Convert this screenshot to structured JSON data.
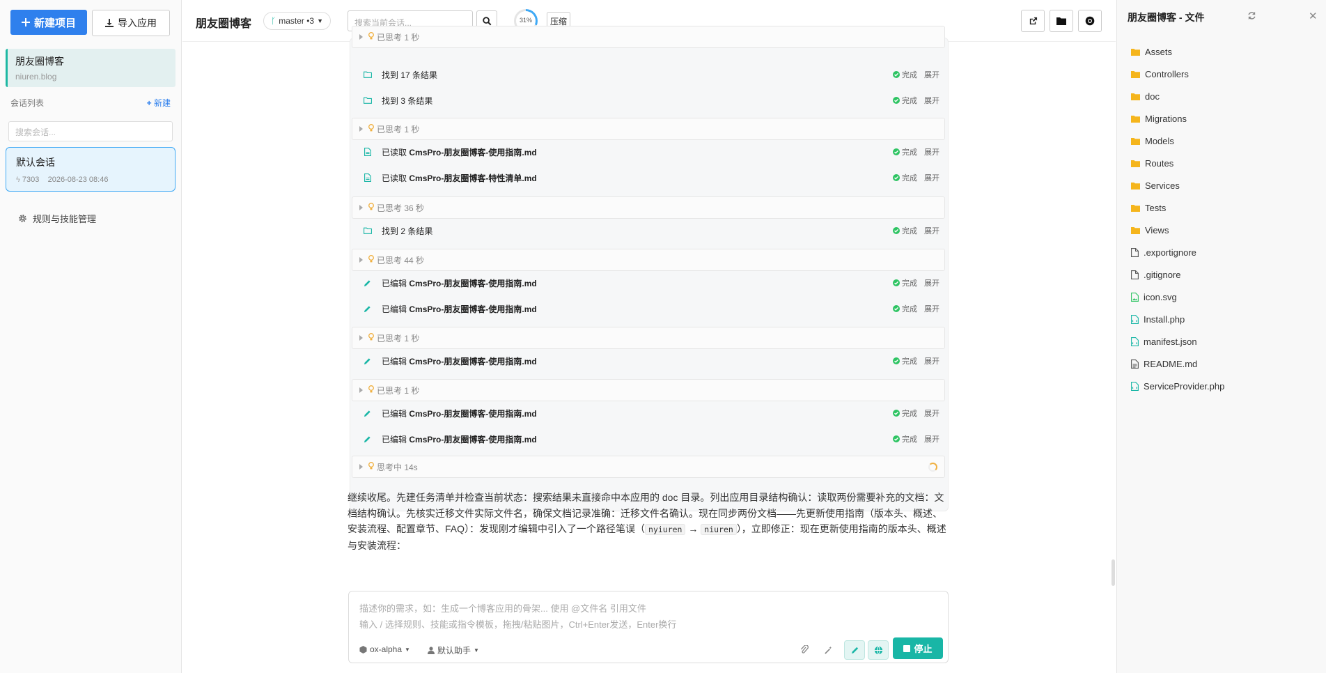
{
  "sidebar": {
    "new_project": "新建项目",
    "import_app": "导入应用",
    "project": {
      "name": "朋友圈博客",
      "domain": "niuren.blog"
    },
    "sessions_label": "会话列表",
    "new_session": "新建",
    "search_placeholder": "搜索会话...",
    "session": {
      "title": "默认会话",
      "count": "7303",
      "time": "2026-08-23 08:46"
    },
    "rules": "规则与技能管理"
  },
  "header": {
    "title": "朋友圈博客",
    "branch": "master •3",
    "search_placeholder": "搜索当前会话...",
    "context_percent": "31%",
    "context_fraction": 0.31,
    "compress": "压缩"
  },
  "steps": [
    {
      "kind": "think",
      "text": "已思考 1 秒"
    },
    {
      "kind": "folder",
      "text": "找到 17 条结果",
      "status": "完成",
      "expand": "展开"
    },
    {
      "kind": "folder",
      "text": "找到 3 条结果",
      "status": "完成",
      "expand": "展开"
    },
    {
      "kind": "think",
      "text": "已思考 1 秒"
    },
    {
      "kind": "read",
      "prefix": "已读取",
      "file": "CmsPro-朋友圈博客-使用指南.md",
      "status": "完成",
      "expand": "展开"
    },
    {
      "kind": "read",
      "prefix": "已读取",
      "file": "CmsPro-朋友圈博客-特性清单.md",
      "status": "完成",
      "expand": "展开"
    },
    {
      "kind": "think",
      "text": "已思考 36 秒"
    },
    {
      "kind": "folder",
      "text": "找到 2 条结果",
      "status": "完成",
      "expand": "展开"
    },
    {
      "kind": "think",
      "text": "已思考 44 秒"
    },
    {
      "kind": "edit",
      "prefix": "已编辑",
      "file": "CmsPro-朋友圈博客-使用指南.md",
      "status": "完成",
      "expand": "展开"
    },
    {
      "kind": "edit",
      "prefix": "已编辑",
      "file": "CmsPro-朋友圈博客-使用指南.md",
      "status": "完成",
      "expand": "展开"
    },
    {
      "kind": "think",
      "text": "已思考 1 秒"
    },
    {
      "kind": "edit",
      "prefix": "已编辑",
      "file": "CmsPro-朋友圈博客-使用指南.md",
      "status": "完成",
      "expand": "展开"
    },
    {
      "kind": "think",
      "text": "已思考 1 秒"
    },
    {
      "kind": "edit",
      "prefix": "已编辑",
      "file": "CmsPro-朋友圈博客-使用指南.md",
      "status": "完成",
      "expand": "展开"
    },
    {
      "kind": "edit",
      "prefix": "已编辑",
      "file": "CmsPro-朋友圈博客-使用指南.md",
      "status": "完成",
      "expand": "展开"
    },
    {
      "kind": "thinking",
      "text": "思考中 14s"
    }
  ],
  "message": {
    "text_1": "继续收尾。先建任务清单并检查当前状态：搜索结果未直接命中本应用的 doc 目录。列出应用目录结构确认：读取两份需要补充的文档：文档结构确认。先核实迁移文件实际文件名，确保文档记录准确：迁移文件名确认。现在同步两份文档——先更新使用指南（版本头、概述、安装流程、配置章节、FAQ）：发现刚才编辑中引入了一个路径笔误（",
    "code_1": "nyiuren",
    "arrow": "→",
    "code_2": "niuren",
    "text_2": "），立即修正：现在更新使用指南的版本头、概述与安装流程："
  },
  "composer": {
    "placeholder_1": "描述你的需求，如：生成一个博客应用的骨架... 使用 @文件名 引用文件",
    "placeholder_2": "输入 / 选择规则、技能或指令模板，拖拽/粘贴图片，Ctrl+Enter发送，Enter换行",
    "model": "ox-alpha",
    "assistant": "默认助手",
    "stop": "停止"
  },
  "files": {
    "title": "朋友圈博客 - 文件",
    "folders": [
      "Assets",
      "Controllers",
      "doc",
      "Migrations",
      "Models",
      "Routes",
      "Services",
      "Tests",
      "Views"
    ],
    "items": [
      {
        "name": ".exportignore",
        "icon": "file-icon"
      },
      {
        "name": ".gitignore",
        "icon": "file-icon"
      },
      {
        "name": "icon.svg",
        "icon": "image-file-icon"
      },
      {
        "name": "Install.php",
        "icon": "code-file-icon"
      },
      {
        "name": "manifest.json",
        "icon": "code-file-icon"
      },
      {
        "name": "README.md",
        "icon": "text-file-icon"
      },
      {
        "name": "ServiceProvider.php",
        "icon": "code-file-icon"
      }
    ]
  },
  "colors": {
    "primary": "#2f80ed",
    "accent": "#19b6a6",
    "success": "#2ec463",
    "bulb": "#f0b040",
    "folder": "#f5b51c"
  }
}
